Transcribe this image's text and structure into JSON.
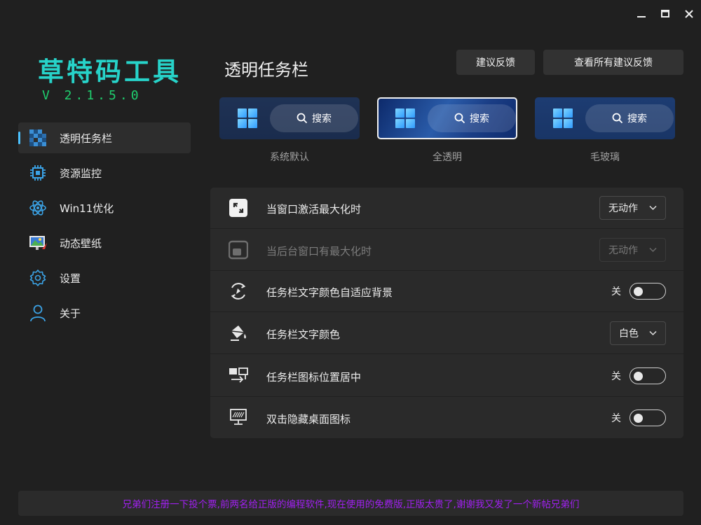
{
  "app": {
    "title": "草特码工具",
    "version": "V 2.1.5.0"
  },
  "window_controls": [
    "minimize-icon",
    "maximize-icon",
    "close-icon"
  ],
  "sidebar": {
    "items": [
      {
        "label": "透明任务栏",
        "icon": "taskbar-pixel-icon",
        "active": true
      },
      {
        "label": "资源监控",
        "icon": "chip-icon",
        "active": false
      },
      {
        "label": "Win11优化",
        "icon": "atom-icon",
        "active": false
      },
      {
        "label": "动态壁纸",
        "icon": "wallpaper-icon",
        "active": false
      },
      {
        "label": "设置",
        "icon": "gear-icon",
        "active": false
      },
      {
        "label": "关于",
        "icon": "person-icon",
        "active": false
      }
    ]
  },
  "page": {
    "title": "透明任务栏",
    "buttons": {
      "feedback": "建议反馈",
      "all_feedback": "查看所有建议反馈"
    }
  },
  "previews": [
    {
      "search": "搜索",
      "label": "系统默认",
      "selected": false
    },
    {
      "search": "搜索",
      "label": "全透明",
      "selected": true
    },
    {
      "search": "搜索",
      "label": "毛玻璃",
      "selected": false
    }
  ],
  "settings": {
    "rows": [
      {
        "label": "当窗口激活最大化时",
        "icon": "maximize-window-icon",
        "control": "dropdown",
        "value": "无动作",
        "disabled": false
      },
      {
        "label": "当后台窗口有最大化时",
        "icon": "background-window-icon",
        "control": "dropdown",
        "value": "无动作",
        "disabled": true
      },
      {
        "label": "任务栏文字颜色自适应背景",
        "icon": "adaptive-color-icon",
        "control": "toggle",
        "state_text": "关",
        "on": false
      },
      {
        "label": "任务栏文字颜色",
        "icon": "paint-bucket-icon",
        "control": "dropdown",
        "value": "白色",
        "disabled": false
      },
      {
        "label": "任务栏图标位置居中",
        "icon": "center-align-icon",
        "control": "toggle",
        "state_text": "关",
        "on": false
      },
      {
        "label": "双击隐藏桌面图标",
        "icon": "monitor-icon",
        "control": "toggle",
        "state_text": "关",
        "on": false
      }
    ]
  },
  "footer": {
    "text": "兄弟们注册一下投个票,前两名给正版的编程软件,现在使用的免费版,正版太贵了,谢谢我又发了一个新帖兄弟们"
  },
  "colors": {
    "background": "#202020",
    "accent": "#4cc2ff",
    "logo": "#27d3c9",
    "version": "#1fce6e",
    "footer_text": "#a020f0"
  }
}
